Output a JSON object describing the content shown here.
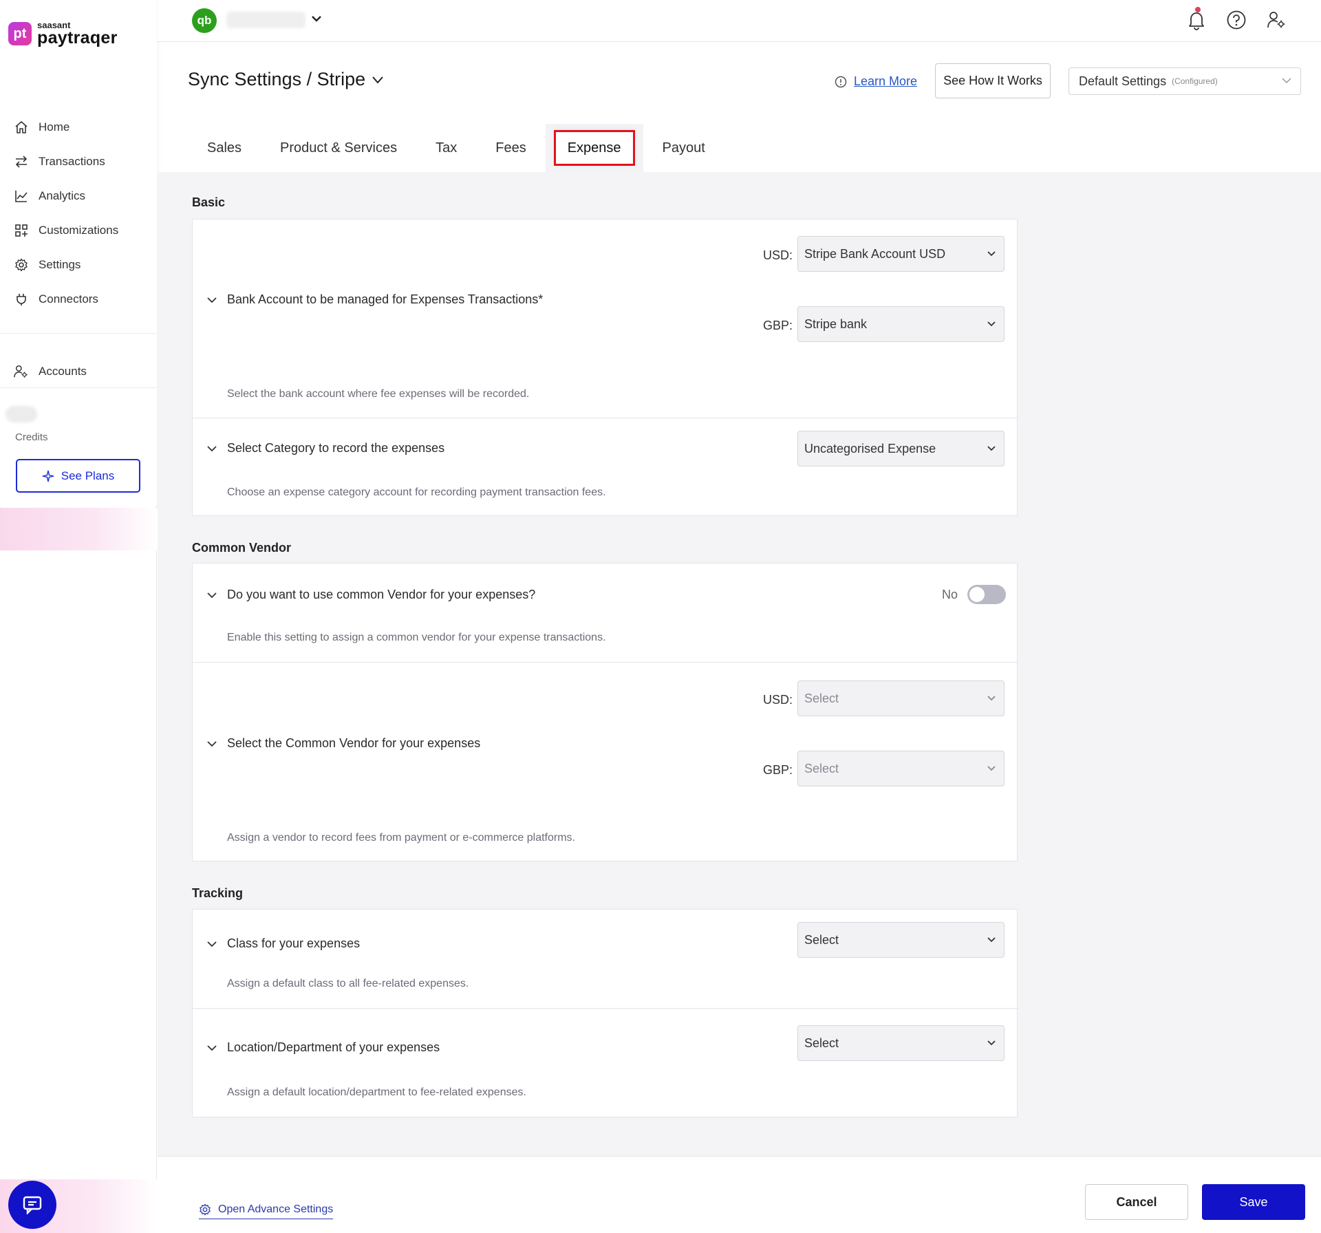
{
  "brand": {
    "logo_mark": "pt",
    "logo_small": "saasant",
    "logo_name": "paytraqer"
  },
  "sidebar": {
    "items": [
      {
        "label": "Home",
        "icon": "home-icon"
      },
      {
        "label": "Transactions",
        "icon": "transfer-icon"
      },
      {
        "label": "Analytics",
        "icon": "chart-icon"
      },
      {
        "label": "Customizations",
        "icon": "grid-icon"
      },
      {
        "label": "Settings",
        "icon": "gear-icon"
      },
      {
        "label": "Connectors",
        "icon": "plug-icon"
      }
    ],
    "accounts_label": "Accounts",
    "credits_label": "Credits",
    "see_plans_label": "See Plans"
  },
  "topbar": {
    "qb_logo": "qb"
  },
  "header": {
    "title": "Sync Settings / Stripe",
    "learn_more": "Learn More",
    "see_how": "See How It Works",
    "default_settings": "Default Settings",
    "default_settings_sub": "(Configured)"
  },
  "tabs": [
    {
      "label": "Sales"
    },
    {
      "label": "Product & Services"
    },
    {
      "label": "Tax"
    },
    {
      "label": "Fees"
    },
    {
      "label": "Expense",
      "active": true
    },
    {
      "label": "Payout"
    }
  ],
  "sections": {
    "basic": {
      "title": "Basic",
      "bank_account": {
        "title": "Bank Account to be managed for Expenses Transactions*",
        "usd_label": "USD:",
        "usd_value": "Stripe Bank Account USD",
        "gbp_label": "GBP:",
        "gbp_value": "Stripe bank",
        "desc": "Select the bank account where fee expenses will be recorded."
      },
      "category": {
        "title": "Select Category to record the expenses",
        "value": "Uncategorised Expense",
        "desc": "Choose an expense category account for recording payment transaction fees."
      }
    },
    "common_vendor": {
      "title": "Common Vendor",
      "use_vendor": {
        "title": "Do you want to use common Vendor for your expenses?",
        "toggle_label": "No",
        "desc": "Enable this setting to assign a common vendor for your expense transactions."
      },
      "select_vendor": {
        "title": "Select the Common Vendor for your expenses",
        "usd_label": "USD:",
        "usd_value": "Select",
        "gbp_label": "GBP:",
        "gbp_value": "Select",
        "desc": "Assign a vendor to record fees from payment or e-commerce platforms."
      }
    },
    "tracking": {
      "title": "Tracking",
      "class": {
        "title": "Class for your expenses",
        "value": "Select",
        "desc": "Assign a default class to all fee-related expenses."
      },
      "location": {
        "title": "Location/Department of your expenses",
        "value": "Select",
        "desc": "Assign a default location/department to fee-related expenses."
      }
    }
  },
  "footer": {
    "advance_settings": "Open Advance Settings",
    "cancel": "Cancel",
    "save": "Save"
  },
  "colors": {
    "accent": "#1212c9",
    "active_tab_border": "#e3121b",
    "link": "#2657c6",
    "qb_green": "#2ca01c"
  }
}
